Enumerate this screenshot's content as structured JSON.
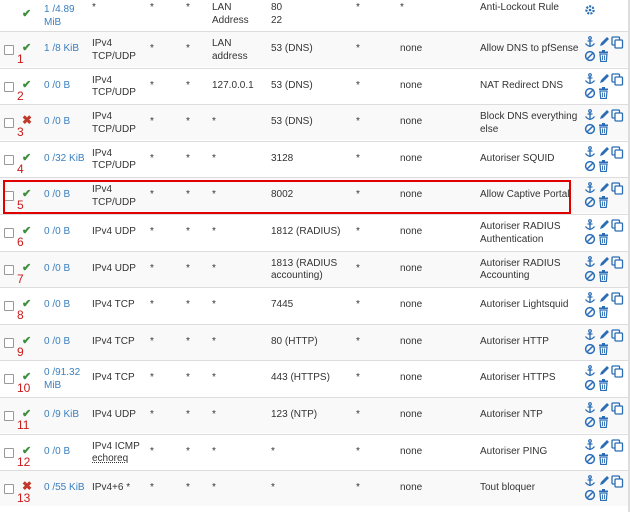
{
  "colors": {
    "ok": "#3c8f3c",
    "blocked": "#c0392b",
    "link": "#3a7fbf",
    "marker": "#cc1a1a",
    "highlight": "#e00000",
    "action_icon": "#2a6db5"
  },
  "icons": {
    "pass": "check-icon",
    "block": "x-icon",
    "settings": "gear-icon",
    "anchor": "anchor-icon",
    "edit": "pencil-icon",
    "copy": "copy-icon",
    "disable": "ban-icon",
    "delete": "trash-icon"
  },
  "top_row": {
    "state_line1": "1 /4.89",
    "state_line2": "MiB",
    "protocol": "*",
    "source": "*",
    "source_port": "*",
    "destination_line1": "LAN",
    "destination_line2": "Address",
    "destination_port_line1": "80",
    "destination_port_line2": "22",
    "gateway": "*",
    "queue": "*",
    "description": "Anti-Lockout Rule"
  },
  "rules": [
    {
      "number": "1",
      "status": "pass",
      "state_line1": "1 /8 KiB",
      "state_line2": "",
      "protocol_line1": "IPv4",
      "protocol_line2": "TCP/UDP",
      "source": "*",
      "source_port": "*",
      "destination_line1": "LAN",
      "destination_line2": "address",
      "destination_port_line1": "53 (DNS)",
      "destination_port_line2": "",
      "gateway": "*",
      "queue": "none",
      "description_line1": "Allow DNS to pfSense",
      "description_line2": ""
    },
    {
      "number": "2",
      "status": "pass",
      "state_line1": "0 /0 B",
      "state_line2": "",
      "protocol_line1": "IPv4",
      "protocol_line2": "TCP/UDP",
      "source": "*",
      "source_port": "*",
      "destination_line1": "127.0.0.1",
      "destination_line2": "",
      "destination_port_line1": "53 (DNS)",
      "destination_port_line2": "",
      "gateway": "*",
      "queue": "none",
      "description_line1": "NAT Redirect DNS",
      "description_line2": ""
    },
    {
      "number": "3",
      "status": "block",
      "state_line1": "0 /0 B",
      "state_line2": "",
      "protocol_line1": "IPv4",
      "protocol_line2": "TCP/UDP",
      "source": "*",
      "source_port": "*",
      "destination_line1": "*",
      "destination_line2": "",
      "destination_port_line1": "53 (DNS)",
      "destination_port_line2": "",
      "gateway": "*",
      "queue": "none",
      "description_line1": "Block DNS everything",
      "description_line2": "else"
    },
    {
      "number": "4",
      "status": "pass",
      "state_line1": "0 /32 KiB",
      "state_line2": "",
      "protocol_line1": "IPv4",
      "protocol_line2": "TCP/UDP",
      "source": "*",
      "source_port": "*",
      "destination_line1": "*",
      "destination_line2": "",
      "destination_port_line1": "3128",
      "destination_port_line2": "",
      "gateway": "*",
      "queue": "none",
      "description_line1": "Autoriser SQUID",
      "description_line2": ""
    },
    {
      "number": "5",
      "status": "pass",
      "state_line1": "0 /0 B",
      "state_line2": "",
      "protocol_line1": "IPv4",
      "protocol_line2": "TCP/UDP",
      "source": "*",
      "source_port": "*",
      "destination_line1": "*",
      "destination_line2": "",
      "destination_port_line1": "8002",
      "destination_port_line2": "",
      "gateway": "*",
      "queue": "none",
      "description_line1": "Allow Captive Portal",
      "description_line2": ""
    },
    {
      "number": "6",
      "status": "pass",
      "state_line1": "0 /0 B",
      "state_line2": "",
      "protocol_line1": "IPv4 UDP",
      "protocol_line2": "",
      "source": "*",
      "source_port": "*",
      "destination_line1": "*",
      "destination_line2": "",
      "destination_port_line1": "1812 (RADIUS)",
      "destination_port_line2": "",
      "gateway": "*",
      "queue": "none",
      "description_line1": "Autoriser RADIUS",
      "description_line2": "Authentication"
    },
    {
      "number": "7",
      "status": "pass",
      "state_line1": "0 /0 B",
      "state_line2": "",
      "protocol_line1": "IPv4 UDP",
      "protocol_line2": "",
      "source": "*",
      "source_port": "*",
      "destination_line1": "*",
      "destination_line2": "",
      "destination_port_line1": "1813 (RADIUS",
      "destination_port_line2": "accounting)",
      "gateway": "*",
      "queue": "none",
      "description_line1": "Autoriser RADIUS",
      "description_line2": "Accounting"
    },
    {
      "number": "8",
      "status": "pass",
      "state_line1": "0 /0 B",
      "state_line2": "",
      "protocol_line1": "IPv4 TCP",
      "protocol_line2": "",
      "source": "*",
      "source_port": "*",
      "destination_line1": "*",
      "destination_line2": "",
      "destination_port_line1": "7445",
      "destination_port_line2": "",
      "gateway": "*",
      "queue": "none",
      "description_line1": "Autoriser Lightsquid",
      "description_line2": ""
    },
    {
      "number": "9",
      "status": "pass",
      "state_line1": "0 /0 B",
      "state_line2": "",
      "protocol_line1": "IPv4 TCP",
      "protocol_line2": "",
      "source": "*",
      "source_port": "*",
      "destination_line1": "*",
      "destination_line2": "",
      "destination_port_line1": "80 (HTTP)",
      "destination_port_line2": "",
      "gateway": "*",
      "queue": "none",
      "description_line1": "Autoriser HTTP",
      "description_line2": ""
    },
    {
      "number": "10",
      "status": "pass",
      "state_line1": "0 /91.32",
      "state_line2": "MiB",
      "protocol_line1": "IPv4 TCP",
      "protocol_line2": "",
      "source": "*",
      "source_port": "*",
      "destination_line1": "*",
      "destination_line2": "",
      "destination_port_line1": "443 (HTTPS)",
      "destination_port_line2": "",
      "gateway": "*",
      "queue": "none",
      "description_line1": "Autoriser HTTPS",
      "description_line2": ""
    },
    {
      "number": "11",
      "status": "pass",
      "state_line1": "0 /9 KiB",
      "state_line2": "",
      "protocol_line1": "IPv4 UDP",
      "protocol_line2": "",
      "source": "*",
      "source_port": "*",
      "destination_line1": "*",
      "destination_line2": "",
      "destination_port_line1": "123 (NTP)",
      "destination_port_line2": "",
      "gateway": "*",
      "queue": "none",
      "description_line1": "Autoriser NTP",
      "description_line2": ""
    },
    {
      "number": "12",
      "status": "pass",
      "state_line1": "0 /0 B",
      "state_line2": "",
      "protocol_line1": "IPv4 ICMP",
      "protocol_line2": "echoreq",
      "source": "*",
      "source_port": "*",
      "destination_line1": "*",
      "destination_line2": "",
      "destination_port_line1": "*",
      "destination_port_line2": "",
      "gateway": "*",
      "queue": "none",
      "description_line1": "Autoriser PING",
      "description_line2": ""
    },
    {
      "number": "13",
      "status": "block",
      "state_line1": "0 /55 KiB",
      "state_line2": "",
      "protocol_line1": "IPv4+6 *",
      "protocol_line2": "",
      "source": "*",
      "source_port": "*",
      "destination_line1": "*",
      "destination_line2": "",
      "destination_port_line1": "*",
      "destination_port_line2": "",
      "gateway": "*",
      "queue": "none",
      "description_line1": "Tout bloquer",
      "description_line2": ""
    }
  ]
}
